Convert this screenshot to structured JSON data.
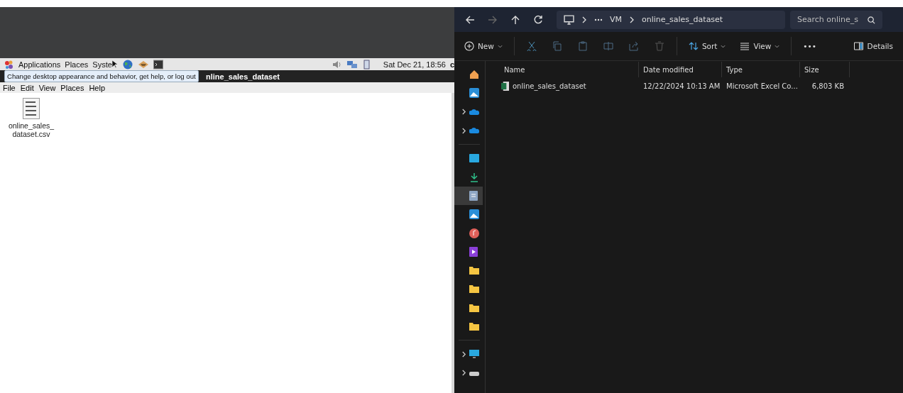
{
  "linux_panel": {
    "menus": [
      "Applications",
      "Places",
      "Syste"
    ],
    "clock": "Sat Dec 21, 18:56",
    "clock_cut": "c"
  },
  "tooltip": "Change desktop appearance and behavior, get help, or log out",
  "linux_window": {
    "title": "nline_sales_dataset",
    "menu": [
      "File",
      "Edit",
      "View",
      "Places",
      "Help"
    ]
  },
  "desktop_file": {
    "name": "online_sales_\ndataset.csv"
  },
  "explorer": {
    "breadcrumb": [
      "VM",
      "online_sales_dataset"
    ],
    "search": {
      "placeholder": "Search online_s"
    },
    "toolbar": {
      "new": "New",
      "sort": "Sort",
      "view": "View",
      "more": "•••",
      "details": "Details"
    },
    "sidebar": [
      {
        "kind": "home",
        "expandable": false,
        "selected": false
      },
      {
        "kind": "gallery",
        "expandable": false,
        "selected": false
      },
      {
        "kind": "cloud",
        "expandable": true,
        "selected": false
      },
      {
        "kind": "cloud",
        "expandable": true,
        "selected": false
      },
      {
        "kind": "separator"
      },
      {
        "kind": "desktop",
        "expandable": false,
        "selected": false
      },
      {
        "kind": "download",
        "expandable": false,
        "selected": false
      },
      {
        "kind": "document",
        "expandable": false,
        "selected": true
      },
      {
        "kind": "pictures",
        "expandable": false,
        "selected": false
      },
      {
        "kind": "music",
        "expandable": false,
        "selected": false
      },
      {
        "kind": "video",
        "expandable": false,
        "selected": false
      },
      {
        "kind": "folder",
        "expandable": false,
        "selected": false
      },
      {
        "kind": "folder",
        "expandable": false,
        "selected": false
      },
      {
        "kind": "folder",
        "expandable": false,
        "selected": false
      },
      {
        "kind": "folder",
        "expandable": false,
        "selected": false
      },
      {
        "kind": "separator"
      },
      {
        "kind": "pc",
        "expandable": true,
        "selected": false
      },
      {
        "kind": "drive",
        "expandable": true,
        "selected": false
      }
    ],
    "columns": [
      "Name",
      "Date modified",
      "Type",
      "Size"
    ],
    "rows": [
      {
        "name": "online_sales_dataset",
        "date": "12/22/2024 10:13 AM",
        "type": "Microsoft Excel Co...",
        "size": "6,803 KB"
      }
    ]
  }
}
